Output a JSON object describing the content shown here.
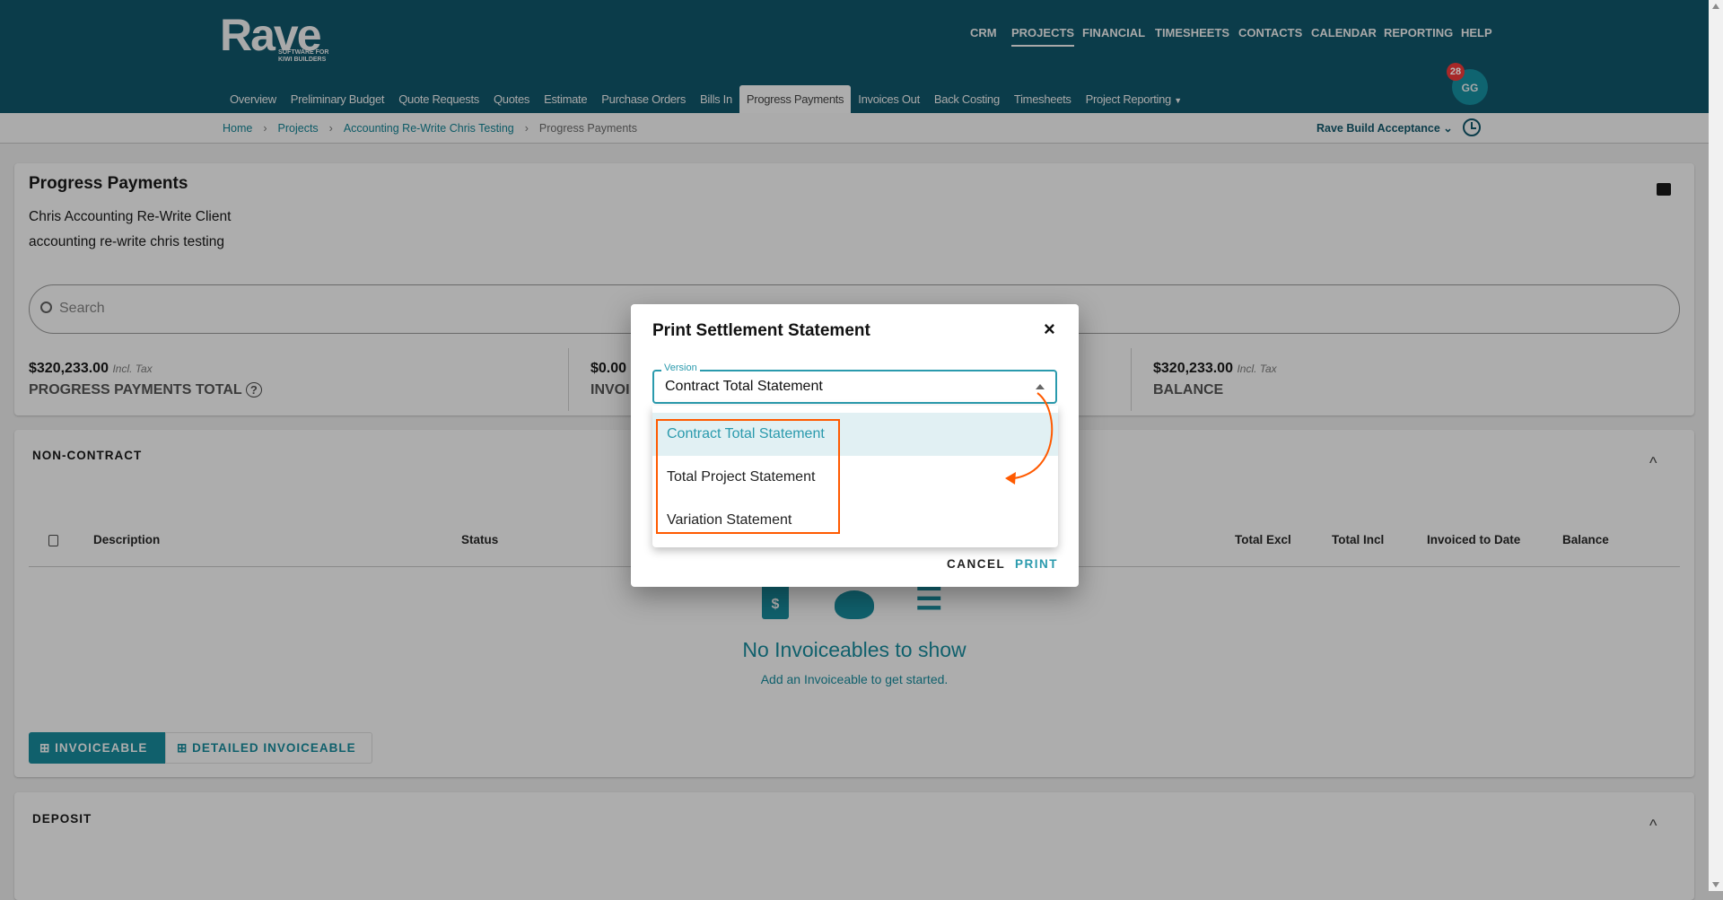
{
  "header": {
    "logo": "Rave",
    "logo_tagline_1": "SOFTWARE FOR",
    "logo_tagline_2": "KIWI BUILDERS",
    "top_nav": [
      "CRM",
      "PROJECTS",
      "FINANCIAL",
      "TIMESHEETS",
      "CONTACTS",
      "CALENDAR",
      "REPORTING",
      "HELP"
    ],
    "tabs": [
      "Overview",
      "Preliminary Budget",
      "Quote Requests",
      "Quotes",
      "Estimate",
      "Purchase Orders",
      "Bills In",
      "Progress Payments",
      "Invoices Out",
      "Back Costing",
      "Timesheets",
      "Project Reporting"
    ],
    "avatar_initials": "GG",
    "notification_count": "28"
  },
  "breadcrumb": [
    "Home",
    "Projects",
    "Accounting Re-Write Chris Testing",
    "Progress Payments"
  ],
  "org_selector": "Rave Build Acceptance",
  "summary": {
    "title": "Progress Payments",
    "client": "Chris Accounting Re-Write Client",
    "project": "accounting re-write chris testing",
    "search_placeholder": "Search",
    "stats": [
      {
        "amount": "$320,233.00",
        "tax": "Incl. Tax",
        "label": "PROGRESS PAYMENTS TOTAL"
      },
      {
        "amount": "$0.00",
        "tax": "",
        "label": "INVOI"
      },
      {
        "amount": "$320,233.00",
        "tax": "Incl. Tax",
        "label": "BALANCE"
      }
    ]
  },
  "non_contract": {
    "title": "NON-CONTRACT",
    "columns": [
      "Description",
      "Status",
      "Total Excl",
      "Total Incl",
      "Invoiced to Date",
      "Balance"
    ],
    "empty_title": "No Invoiceables to show",
    "empty_sub": "Add an Invoiceable to get started.",
    "btn_invoiceable": "INVOICEABLE",
    "btn_detailed": "DETAILED INVOICEABLE"
  },
  "deposit": {
    "title": "DEPOSIT"
  },
  "dialog": {
    "title": "Print Settlement Statement",
    "field_label": "Version",
    "value": "Contract Total Statement",
    "options": [
      "Contract Total Statement",
      "Total Project Statement",
      "Variation Statement"
    ],
    "cancel": "CANCEL",
    "print": "PRINT"
  },
  "colors": {
    "header": "#0b3c4a",
    "accent": "#2a9aad",
    "annotation": "#ff5a00"
  }
}
